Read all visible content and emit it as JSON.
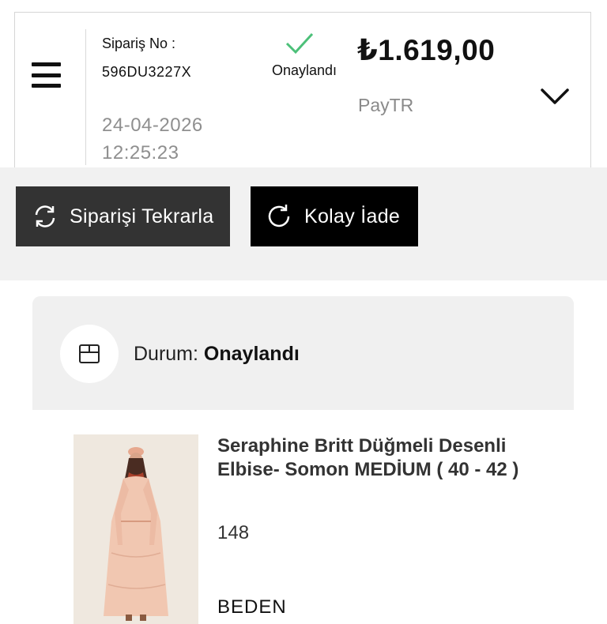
{
  "order": {
    "label": "Sipariş No :",
    "number": "596DU3227X",
    "date": "24-04-2026",
    "time": "12:25:23",
    "status": "Onaylandı",
    "price": "₺1.619,00",
    "payment": "PayTR"
  },
  "icons": {
    "menu": "hamburger-icon",
    "status": "check-icon",
    "expand": "chevron-down-icon",
    "repeat": "repeat-icon",
    "return": "return-icon",
    "box": "box-icon"
  },
  "actions": {
    "repeat_label": "Siparişi Tekrarla",
    "return_label": "Kolay İade"
  },
  "status_card": {
    "label": "Durum:",
    "value": "Onaylandı"
  },
  "item": {
    "name": "Seraphine Britt Düğmeli Desenli Elbise- Somon MEDİUM ( 40 - 42 )",
    "code": "148",
    "size_label": "BEDEN"
  },
  "colors": {
    "check": "#4cc079",
    "repeat_button": "#333333",
    "return_button": "#000000",
    "panel_bg": "#f0f0f0"
  }
}
